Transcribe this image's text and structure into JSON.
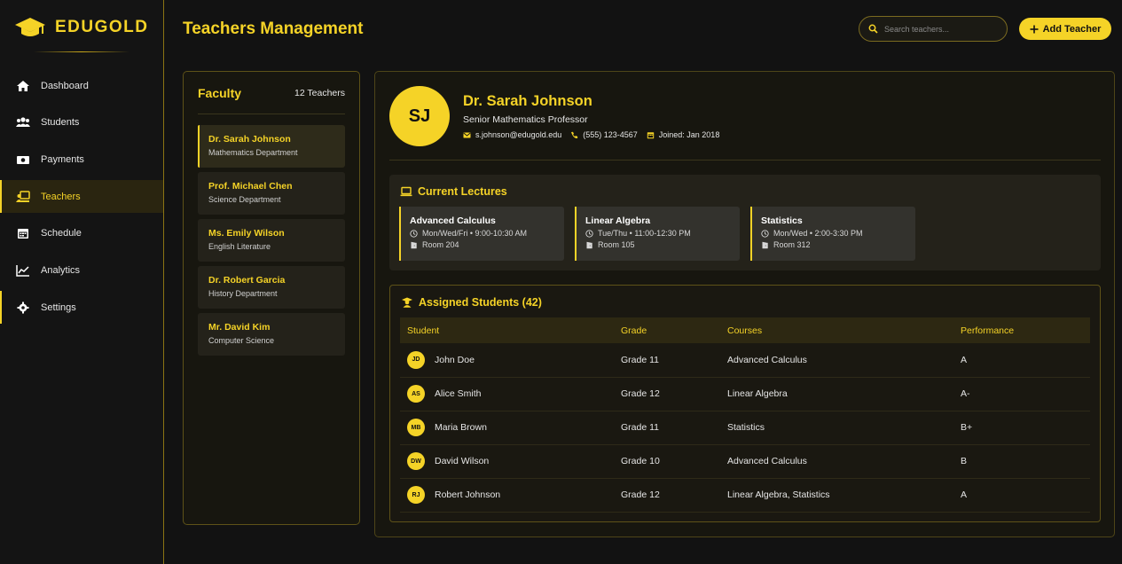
{
  "brand": {
    "name": "EDUGOLD"
  },
  "nav": [
    {
      "label": "Dashboard",
      "icon": "home-icon"
    },
    {
      "label": "Students",
      "icon": "users-icon"
    },
    {
      "label": "Payments",
      "icon": "money-icon"
    },
    {
      "label": "Teachers",
      "icon": "teacher-icon",
      "active": true
    },
    {
      "label": "Schedule",
      "icon": "calendar-icon"
    },
    {
      "label": "Analytics",
      "icon": "chart-line-icon"
    },
    {
      "label": "Settings",
      "icon": "gear-icon"
    }
  ],
  "header": {
    "title": "Teachers Management",
    "search_placeholder": "Search teachers...",
    "add_button": "Add Teacher"
  },
  "faculty": {
    "title": "Faculty",
    "count": "12 Teachers",
    "teachers": [
      {
        "name": "Dr. Sarah Johnson",
        "dept": "Mathematics Department"
      },
      {
        "name": "Prof. Michael Chen",
        "dept": "Science Department"
      },
      {
        "name": "Ms. Emily Wilson",
        "dept": "English Literature"
      },
      {
        "name": "Dr. Robert Garcia",
        "dept": "History Department"
      },
      {
        "name": "Mr. David Kim",
        "dept": "Computer Science"
      }
    ]
  },
  "profile": {
    "initials": "SJ",
    "name": "Dr. Sarah Johnson",
    "role": "Senior Mathematics Professor",
    "email": "s.johnson@edugold.edu",
    "phone": "(555) 123-4567",
    "joined": "Joined: Jan 2018"
  },
  "lectures": {
    "title": "Current Lectures",
    "items": [
      {
        "title": "Advanced Calculus",
        "time": "Mon/Wed/Fri • 9:00-10:30 AM",
        "room": "Room 204"
      },
      {
        "title": "Linear Algebra",
        "time": "Tue/Thu • 11:00-12:30 PM",
        "room": "Room 105"
      },
      {
        "title": "Statistics",
        "time": "Mon/Wed • 2:00-3:30 PM",
        "room": "Room 312"
      }
    ]
  },
  "students": {
    "title": "Assigned Students (42)",
    "columns": [
      "Student",
      "Grade",
      "Courses",
      "Performance"
    ],
    "rows": [
      {
        "initials": "JD",
        "name": "John Doe",
        "grade": "Grade 11",
        "courses": "Advanced Calculus",
        "performance": "A"
      },
      {
        "initials": "AS",
        "name": "Alice Smith",
        "grade": "Grade 12",
        "courses": "Linear Algebra",
        "performance": "A-"
      },
      {
        "initials": "MB",
        "name": "Maria Brown",
        "grade": "Grade 11",
        "courses": "Statistics",
        "performance": "B+"
      },
      {
        "initials": "DW",
        "name": "David Wilson",
        "grade": "Grade 10",
        "courses": "Advanced Calculus",
        "performance": "B"
      },
      {
        "initials": "RJ",
        "name": "Robert Johnson",
        "grade": "Grade 12",
        "courses": "Linear Algebra, Statistics",
        "performance": "A"
      }
    ]
  },
  "colors": {
    "accent": "#f5d327",
    "background": "#121212",
    "panel": "#17160f"
  }
}
